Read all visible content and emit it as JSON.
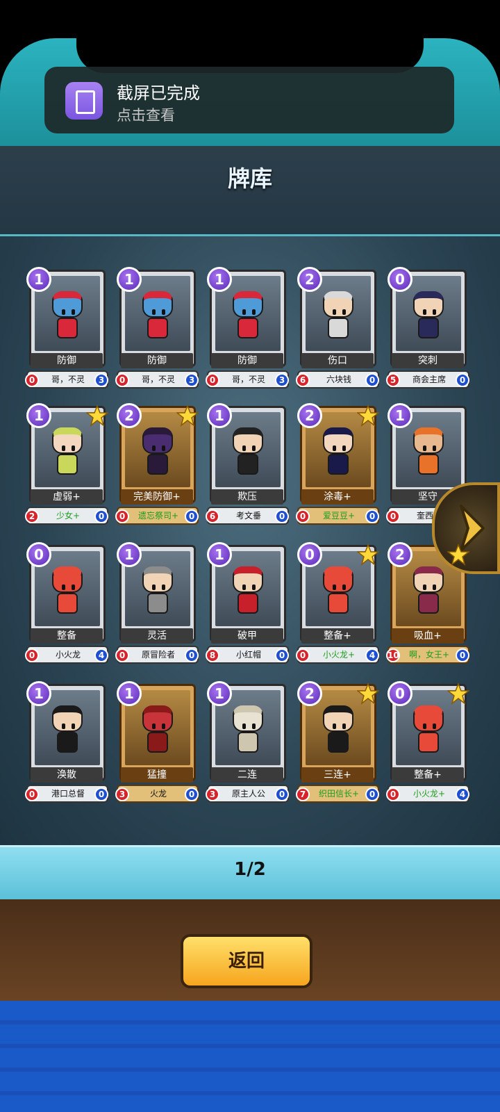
{
  "toast": {
    "title": "截屏已完成",
    "subtitle": "点击查看"
  },
  "page": {
    "title": "牌库",
    "pager": "1/2",
    "back_label": "返回"
  },
  "colors": {
    "cost_badge": "#7a45d6",
    "left_badge": "#d8232a",
    "right_badge": "#1e4fd0",
    "gold_frame": "#d8a55a",
    "green_owner": "#1b9c1b"
  },
  "cards": [
    {
      "cost": "1",
      "name": "防御",
      "left": "0",
      "owner": "哥，不灵",
      "right": "3",
      "gold": false,
      "star": false,
      "green": false,
      "color": "#4f9bd8",
      "hair": "#d8283a"
    },
    {
      "cost": "1",
      "name": "防御",
      "left": "0",
      "owner": "哥，不灵",
      "right": "3",
      "gold": false,
      "star": false,
      "green": false,
      "color": "#4f9bd8",
      "hair": "#d8283a"
    },
    {
      "cost": "1",
      "name": "防御",
      "left": "0",
      "owner": "哥，不灵",
      "right": "3",
      "gold": false,
      "star": false,
      "green": false,
      "color": "#4f9bd8",
      "hair": "#d8283a"
    },
    {
      "cost": "2",
      "name": "伤口",
      "left": "6",
      "owner": "六块钱",
      "right": "0",
      "gold": false,
      "star": false,
      "green": false,
      "color": "#f1d3b5",
      "hair": "#d9d9d9"
    },
    {
      "cost": "0",
      "name": "突刺",
      "left": "5",
      "owner": "商会主席",
      "right": "0",
      "gold": false,
      "star": false,
      "green": false,
      "color": "#f1d3b5",
      "hair": "#2a2a5a"
    },
    {
      "cost": "1",
      "name": "虚弱+",
      "left": "2",
      "owner": "少女+",
      "right": "0",
      "gold": false,
      "star": true,
      "green": true,
      "color": "#f3d7bf",
      "hair": "#c9d85a"
    },
    {
      "cost": "2",
      "name": "完美防御+",
      "left": "0",
      "owner": "遗忘祭司+",
      "right": "0",
      "gold": true,
      "star": true,
      "green": true,
      "color": "#4a2d70",
      "hair": "#2a1a3a"
    },
    {
      "cost": "1",
      "name": "欺压",
      "left": "6",
      "owner": "考文垂",
      "right": "0",
      "gold": false,
      "star": false,
      "green": false,
      "color": "#f1d3b5",
      "hair": "#222"
    },
    {
      "cost": "2",
      "name": "涂毒+",
      "left": "0",
      "owner": "爱豆豆+",
      "right": "0",
      "gold": true,
      "star": true,
      "green": true,
      "color": "#f3d7bf",
      "hair": "#1a1a4a"
    },
    {
      "cost": "1",
      "name": "坚守",
      "left": "0",
      "owner": "奎西干",
      "right": "0",
      "gold": false,
      "star": false,
      "green": false,
      "color": "#e8b88e",
      "hair": "#e8722a"
    },
    {
      "cost": "0",
      "name": "整备",
      "left": "0",
      "owner": "小火龙",
      "right": "4",
      "gold": false,
      "star": false,
      "green": false,
      "color": "#e84a3a",
      "hair": "#e84a3a"
    },
    {
      "cost": "1",
      "name": "灵活",
      "left": "0",
      "owner": "原冒险者",
      "right": "0",
      "gold": false,
      "star": false,
      "green": false,
      "color": "#f1d3b5",
      "hair": "#8c8c8c"
    },
    {
      "cost": "1",
      "name": "破甲",
      "left": "8",
      "owner": "小红帽",
      "right": "0",
      "gold": false,
      "star": false,
      "green": false,
      "color": "#f1d3b5",
      "hair": "#c8202a"
    },
    {
      "cost": "0",
      "name": "整备+",
      "left": "0",
      "owner": "小火龙+",
      "right": "4",
      "gold": false,
      "star": true,
      "green": true,
      "color": "#e84a3a",
      "hair": "#e84a3a"
    },
    {
      "cost": "2",
      "name": "吸血+",
      "left": "10",
      "owner": "啊，女王+",
      "right": "0",
      "gold": true,
      "star": true,
      "green": true,
      "color": "#f1d3b5",
      "hair": "#8a2a4a"
    },
    {
      "cost": "1",
      "name": "涣散",
      "left": "0",
      "owner": "港口总督",
      "right": "0",
      "gold": false,
      "star": false,
      "green": false,
      "color": "#f1d3b5",
      "hair": "#1a1a1a"
    },
    {
      "cost": "1",
      "name": "猛撞",
      "left": "3",
      "owner": "火龙",
      "right": "0",
      "gold": true,
      "star": false,
      "green": false,
      "color": "#c8343a",
      "hair": "#8a1a1a"
    },
    {
      "cost": "1",
      "name": "二连",
      "left": "3",
      "owner": "原主人公",
      "right": "0",
      "gold": false,
      "star": false,
      "green": false,
      "color": "#e8e2d2",
      "hair": "#cfc6b0"
    },
    {
      "cost": "2",
      "name": "三连+",
      "left": "7",
      "owner": "织田信长+",
      "right": "0",
      "gold": true,
      "star": true,
      "green": true,
      "color": "#f1d3b5",
      "hair": "#1a1a1a"
    },
    {
      "cost": "0",
      "name": "整备+",
      "left": "0",
      "owner": "小火龙+",
      "right": "4",
      "gold": false,
      "star": true,
      "green": true,
      "color": "#e84a3a",
      "hair": "#e84a3a"
    }
  ]
}
